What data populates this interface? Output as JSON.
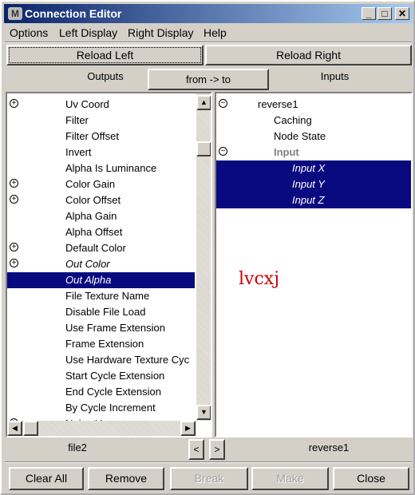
{
  "window": {
    "title": "Connection Editor",
    "icon": "maya-logo-icon"
  },
  "menu": [
    "Options",
    "Left Display",
    "Right Display",
    "Help"
  ],
  "toolbar": {
    "reload_left": "Reload Left",
    "reload_right": "Reload Right",
    "direction": "from -> to",
    "outputs_label": "Outputs",
    "inputs_label": "Inputs"
  },
  "left": {
    "node": "file2",
    "items": [
      {
        "label": "Uv Coord",
        "expand": "plus"
      },
      {
        "label": "Filter"
      },
      {
        "label": "Filter Offset"
      },
      {
        "label": "Invert"
      },
      {
        "label": "Alpha Is Luminance"
      },
      {
        "label": "Color Gain",
        "expand": "plus"
      },
      {
        "label": "Color Offset",
        "expand": "plus"
      },
      {
        "label": "Alpha Gain"
      },
      {
        "label": "Alpha Offset"
      },
      {
        "label": "Default Color",
        "expand": "plus"
      },
      {
        "label": "Out Color",
        "expand": "plus",
        "italic": true
      },
      {
        "label": "Out Alpha",
        "italic": true,
        "selected": true
      },
      {
        "label": "File Texture Name"
      },
      {
        "label": "Disable File Load"
      },
      {
        "label": "Use Frame Extension"
      },
      {
        "label": "Frame Extension"
      },
      {
        "label": "Use Hardware Texture Cyc"
      },
      {
        "label": "Start Cycle Extension"
      },
      {
        "label": "End Cycle Extension"
      },
      {
        "label": "By Cycle Increment"
      },
      {
        "label": "Noise Uv",
        "expand": "plus"
      }
    ]
  },
  "right": {
    "node": "reverse1",
    "items": [
      {
        "label": "reverse1",
        "expand": "minus",
        "indent": 0
      },
      {
        "label": "Caching",
        "indent": 1
      },
      {
        "label": "Node State",
        "indent": 1
      },
      {
        "label": "Input",
        "expand": "minus",
        "indent": 1,
        "bold": true
      },
      {
        "label": "Input X",
        "indent": 2,
        "italic": true,
        "selected": true
      },
      {
        "label": "Input Y",
        "indent": 2,
        "italic": true,
        "selected": true
      },
      {
        "label": "Input Z",
        "indent": 2,
        "italic": true,
        "selected": true
      }
    ]
  },
  "watermark": "lvcxj",
  "buttons": {
    "clear_all": "Clear All",
    "remove": "Remove",
    "break": "Break",
    "make": "Make",
    "close": "Close",
    "prev": "<",
    "next": ">"
  },
  "colors": {
    "selection": "#0a0a80",
    "title_start": "#0a246a",
    "title_end": "#a6caf0",
    "watermark": "#cc0000"
  }
}
